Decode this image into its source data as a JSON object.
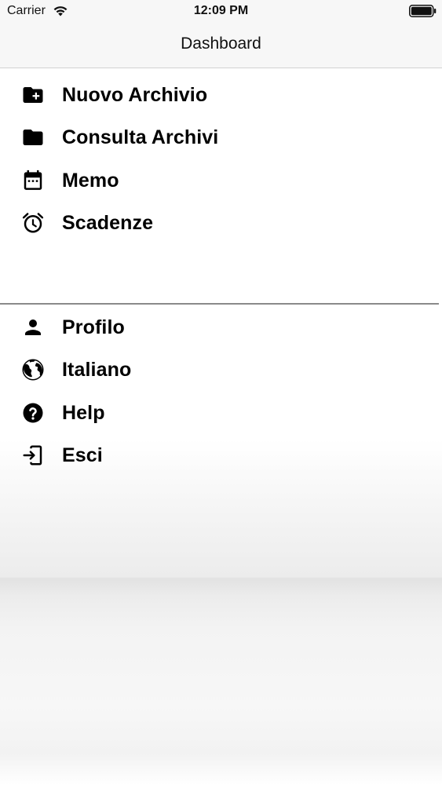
{
  "status_bar": {
    "carrier": "Carrier",
    "time": "12:09 PM",
    "wifi_icon": "wifi-icon",
    "battery_icon": "battery-icon"
  },
  "nav": {
    "title": "Dashboard"
  },
  "menu": {
    "primary": [
      {
        "label": "Nuovo Archivio",
        "icon": "folder-plus-icon"
      },
      {
        "label": "Consulta Archivi",
        "icon": "folder-icon"
      },
      {
        "label": "Memo",
        "icon": "calendar-icon"
      },
      {
        "label": "Scadenze",
        "icon": "alarm-clock-icon"
      }
    ],
    "secondary": [
      {
        "label": "Profilo",
        "icon": "person-icon"
      },
      {
        "label": "Italiano",
        "icon": "globe-icon"
      },
      {
        "label": "Help",
        "icon": "help-circle-icon"
      },
      {
        "label": "Esci",
        "icon": "exit-icon"
      }
    ]
  },
  "colors": {
    "text": "#000000",
    "bar_background": "#f7f7f7",
    "separator": "#8a8a8a"
  }
}
